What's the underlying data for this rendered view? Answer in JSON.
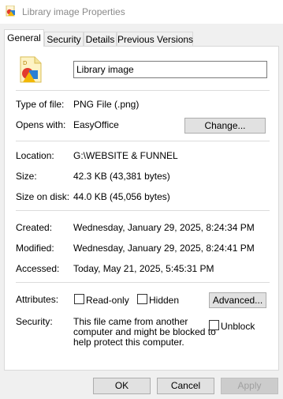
{
  "window": {
    "title": "Library image Properties"
  },
  "tabs": [
    {
      "label": "General",
      "active": true
    },
    {
      "label": "Security",
      "active": false
    },
    {
      "label": "Details",
      "active": false
    },
    {
      "label": "Previous Versions",
      "active": false
    }
  ],
  "file": {
    "icon": "png-image-file-icon",
    "name": "Library image"
  },
  "type_of_file": {
    "label": "Type of file:",
    "value": "PNG File (.png)"
  },
  "opens_with": {
    "label": "Opens with:",
    "value": "EasyOffice",
    "change_label": "Change..."
  },
  "location": {
    "label": "Location:",
    "value": "G:\\WEBSITE & FUNNEL"
  },
  "size": {
    "label": "Size:",
    "value": "42.3 KB (43,381 bytes)"
  },
  "size_on_disk": {
    "label": "Size on disk:",
    "value": "44.0 KB (45,056 bytes)"
  },
  "created": {
    "label": "Created:",
    "value": "Wednesday, January 29, 2025, 8:24:34 PM"
  },
  "modified": {
    "label": "Modified:",
    "value": "Wednesday, January 29, 2025, 8:24:41 PM"
  },
  "accessed": {
    "label": "Accessed:",
    "value": "Today, May 21, 2025, 5:45:31 PM"
  },
  "attributes": {
    "label": "Attributes:",
    "readonly_label": "Read-only",
    "readonly_checked": false,
    "hidden_label": "Hidden",
    "hidden_checked": false,
    "advanced_label": "Advanced..."
  },
  "security": {
    "label": "Security:",
    "message_line1": "This file came from another",
    "message_line2": "computer and might be blocked to",
    "message_line3": "help protect this computer.",
    "unblock_label": "Unblock",
    "unblock_checked": false
  },
  "buttons": {
    "ok": "OK",
    "cancel": "Cancel",
    "apply": "Apply"
  },
  "colors": {
    "title_text": "#8a8a8a",
    "button_face": "#e1e1e1",
    "disabled_text": "#a0a0a0"
  }
}
